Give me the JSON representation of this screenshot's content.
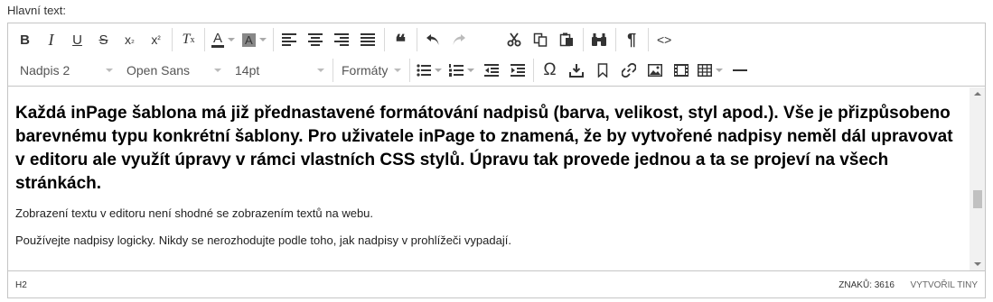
{
  "field_label": "Hlavní text:",
  "toolbar": {
    "bold": "B",
    "italic": "I",
    "underline": "U",
    "strike": "S",
    "sub_main": "x",
    "sub_mark": "₂",
    "sup_main": "x",
    "sup_mark": "²",
    "clear_main": "T",
    "clear_mark": "x",
    "text_color": "A",
    "bg_color": "A",
    "quote": "❝",
    "paragraph": "¶",
    "code": "<>",
    "block_format": "Nadpis 2",
    "font_family": "Open Sans",
    "font_size": "14pt",
    "formats": "Formáty",
    "special_char": "Ω",
    "accent_color": "#d9534f"
  },
  "content": {
    "heading": "Každá inPage šablona má již přednastavené formátování nadpisů (barva, velikost, styl apod.). Vše je přizpůsobeno barevnému typu konkrétní šablony. Pro uživatele inPage to znamená, že by vytvořené nadpisy neměl dál upravovat v editoru ale využít úpravy v rámci vlastních CSS stylů. Úpravu tak provede jednou a ta se projeví na všech stránkách.",
    "paragraphs": [
      "Zobrazení textu v editoru není shodné se zobrazením textů na webu.",
      "Používejte nadpisy logicky. Nikdy se nerozhodujte podle toho, jak nadpisy v prohlížeči vypadají."
    ]
  },
  "statusbar": {
    "path": "H2",
    "count": "ZNAKŮ: 3616",
    "brand": "VYTVOŘIL TINY"
  }
}
